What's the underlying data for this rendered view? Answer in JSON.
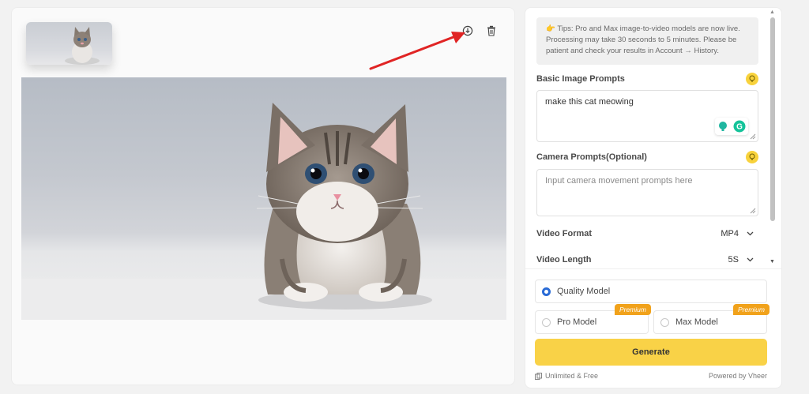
{
  "left": {
    "thumbnail_alt": "kitten thumbnail",
    "download_icon": "download-icon",
    "trash_icon": "trash-icon",
    "annotation_icon": "red-arrow-annotation"
  },
  "right": {
    "tips_text": "Tips: Pro and Max image-to-video models are now live. Processing may take 30 seconds to 5 minutes. Please be patient and check your results in Account → History.",
    "basic_prompt_label": "Basic Image Prompts",
    "basic_prompt_value": "make this cat meowing",
    "camera_prompt_label": "Camera Prompts(Optional)",
    "camera_prompt_placeholder": "Input camera movement prompts here",
    "video_format_label": "Video Format",
    "video_format_value": "MP4",
    "video_length_label": "Video Length",
    "video_length_value": "5S",
    "models": {
      "quality": "Quality Model",
      "pro": "Pro Model",
      "max": "Max Model",
      "premium_badge": "Premium"
    },
    "generate_label": "Generate",
    "footer_left": "Unlimited & Free",
    "footer_right": "Powered by Vheer"
  },
  "colors": {
    "accent_yellow": "#f9d247",
    "premium_orange": "#f1a21b",
    "radio_blue": "#2a6bd6",
    "annotation_red": "#e02424"
  }
}
